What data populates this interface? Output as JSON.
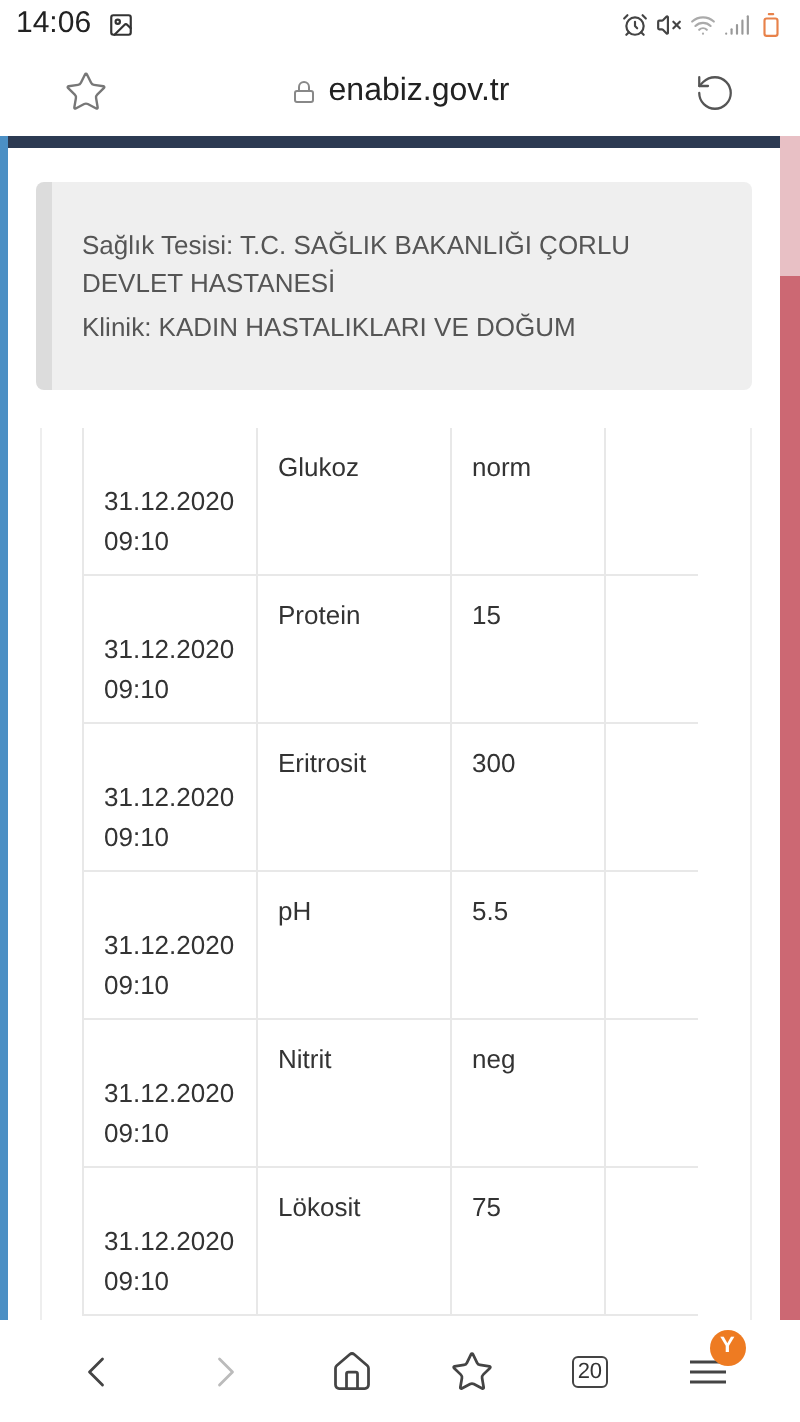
{
  "status_bar": {
    "time": "14:06"
  },
  "address_bar": {
    "url": "enabiz.gov.tr"
  },
  "info_box": {
    "lines": [
      "Sağlık Tesisi: T.C. SAĞLIK BAKANLIĞI ÇORLU DEVLET HASTANESİ",
      "Klinik: KADIN HASTALIKLARI VE DOĞUM"
    ]
  },
  "table": {
    "rows": [
      {
        "date": "31.12.2020",
        "time": "09:10",
        "test": "Glukoz",
        "result": "norm"
      },
      {
        "date": "31.12.2020",
        "time": "09:10",
        "test": "Protein",
        "result": "15"
      },
      {
        "date": "31.12.2020",
        "time": "09:10",
        "test": "Eritrosit",
        "result": "300"
      },
      {
        "date": "31.12.2020",
        "time": "09:10",
        "test": "pH",
        "result": "5.5"
      },
      {
        "date": "31.12.2020",
        "time": "09:10",
        "test": "Nitrit",
        "result": "neg"
      },
      {
        "date": "31.12.2020",
        "time": "09:10",
        "test": "Lökosit",
        "result": "75"
      }
    ]
  },
  "bottom_bar": {
    "tab_count": "20",
    "menu_badge": "Y"
  }
}
